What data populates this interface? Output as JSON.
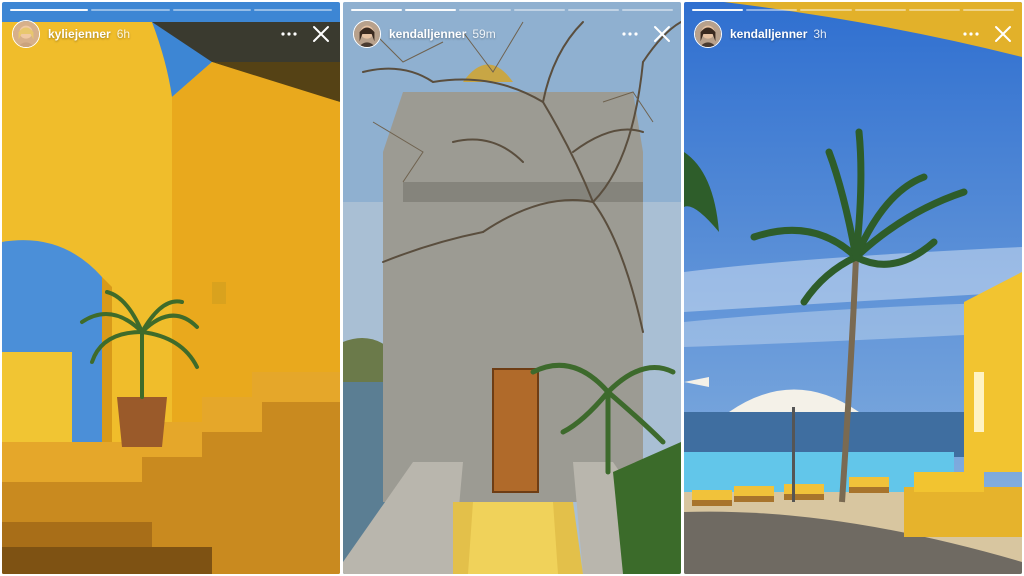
{
  "stories": [
    {
      "username": "kyliejenner",
      "time": "6h",
      "progress_segments": 4,
      "active_segment": 1,
      "avatar_icon": "avatar-kylie",
      "scene": "yellow-stairs-courtyard"
    },
    {
      "username": "kendalljenner",
      "time": "59m",
      "progress_segments": 6,
      "active_segment": 2,
      "avatar_icon": "avatar-kendall",
      "scene": "stone-tower-walkway"
    },
    {
      "username": "kendalljenner",
      "time": "3h",
      "progress_segments": 6,
      "active_segment": 1,
      "avatar_icon": "avatar-kendall",
      "scene": "pool-palm-tree"
    }
  ],
  "icons": {
    "more": "more-horizontal-icon",
    "close": "close-icon"
  },
  "colors": {
    "yellow_wall": "#f2c12e",
    "sky": "#3a7fd0",
    "pool": "#5ec2e6",
    "stone": "#9a9a92"
  }
}
